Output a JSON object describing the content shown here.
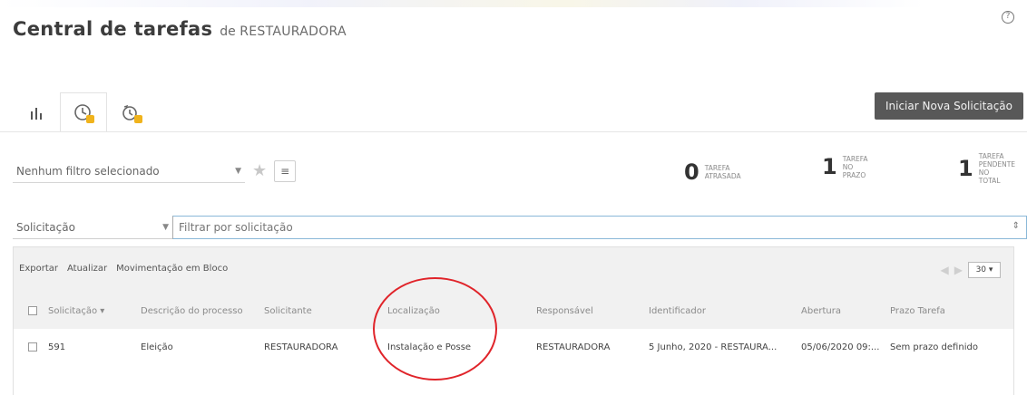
{
  "header": {
    "title": "Central de tarefas",
    "subtitle_prefix": "de",
    "company": "RESTAURADORA",
    "help_icon": "?"
  },
  "tabs": [
    {
      "icon": "bar-chart-icon"
    },
    {
      "icon": "clock-icon",
      "active": true
    },
    {
      "icon": "clock-cycle-icon"
    }
  ],
  "actions": {
    "new_request": "Iniciar Nova Solicitação"
  },
  "filter": {
    "selected": "Nenhum filtro selecionado",
    "filter_button_icon": "≡"
  },
  "counters": [
    {
      "value": "0",
      "label_lines": [
        "TAREFA",
        "ATRASADA"
      ]
    },
    {
      "value": "1",
      "label_lines": [
        "TAREFA",
        "NO",
        "PRAZO"
      ]
    },
    {
      "value": "1",
      "label_lines": [
        "TAREFA",
        "PENDENTE",
        "NO",
        "TOTAL"
      ]
    }
  ],
  "search": {
    "type": "Solicitação",
    "placeholder": "Filtrar por solicitação",
    "sort_icon": "⇕"
  },
  "toolbar": {
    "export": "Exportar",
    "update": "Atualizar",
    "bulk_move": "Movimentação em Bloco",
    "page_size": "30 ▾"
  },
  "table": {
    "columns": [
      "Solicitação ▾",
      "Descrição do processo",
      "Solicitante",
      "Localização",
      "Responsável",
      "Identificador",
      "Abertura",
      "Prazo Tarefa"
    ],
    "rows": [
      [
        "591",
        "Eleição",
        "RESTAURADORA",
        "Instalação e Posse",
        "RESTAURADORA",
        "5 Junho, 2020 - RESTAURA...",
        "05/06/2020 09:...",
        "Sem prazo definido"
      ]
    ]
  },
  "colors": {
    "primary_button": "#585858",
    "badge": "#f0b31c",
    "annotation": "#e0242a"
  }
}
